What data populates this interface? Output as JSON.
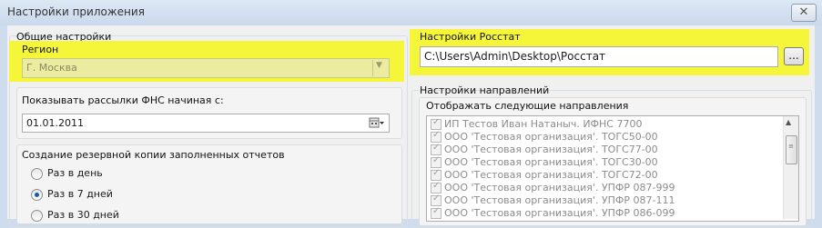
{
  "window": {
    "title": "Настройки приложения",
    "close_label": "✕"
  },
  "general": {
    "group_title": "Общие настройки",
    "region": {
      "label": "Регион",
      "value": "Г. Москва"
    },
    "fns": {
      "label": "Показывать рассылки ФНС начиная с:",
      "date": "01.01.2011"
    },
    "backup": {
      "label": "Создание резервной копии заполненных отчетов",
      "options": [
        "Раз в день",
        "Раз в 7 дней",
        "Раз в 30 дней"
      ],
      "selected": "Раз в 7 дней"
    }
  },
  "rosstat": {
    "label": "Настройки Росстат",
    "path": "C:\\Users\\Admin\\Desktop\\Росстат",
    "browse_label": "..."
  },
  "directions": {
    "group_title": "Настройки направлений",
    "list_label": "Отображать следующие направления",
    "items": [
      "ИП Тестов Иван Натаныч. ИФНС 7700",
      "ООО 'Тестовая организация'. ТОГС50-00",
      "ООО 'Тестовая организация'. ТОГС77-00",
      "ООО 'Тестовая организация'. ТОГС30-00",
      "ООО 'Тестовая организация'. ТОГС72-00",
      "ООО 'Тестовая организация'. УПФР 087-999",
      "ООО 'Тестовая организация'. УПФР 087-111",
      "ООО 'Тестовая организация'. УПФР 086-099"
    ]
  },
  "colors": {
    "highlight": "#f5f53a",
    "selected_radio": "#1b5aa6"
  }
}
